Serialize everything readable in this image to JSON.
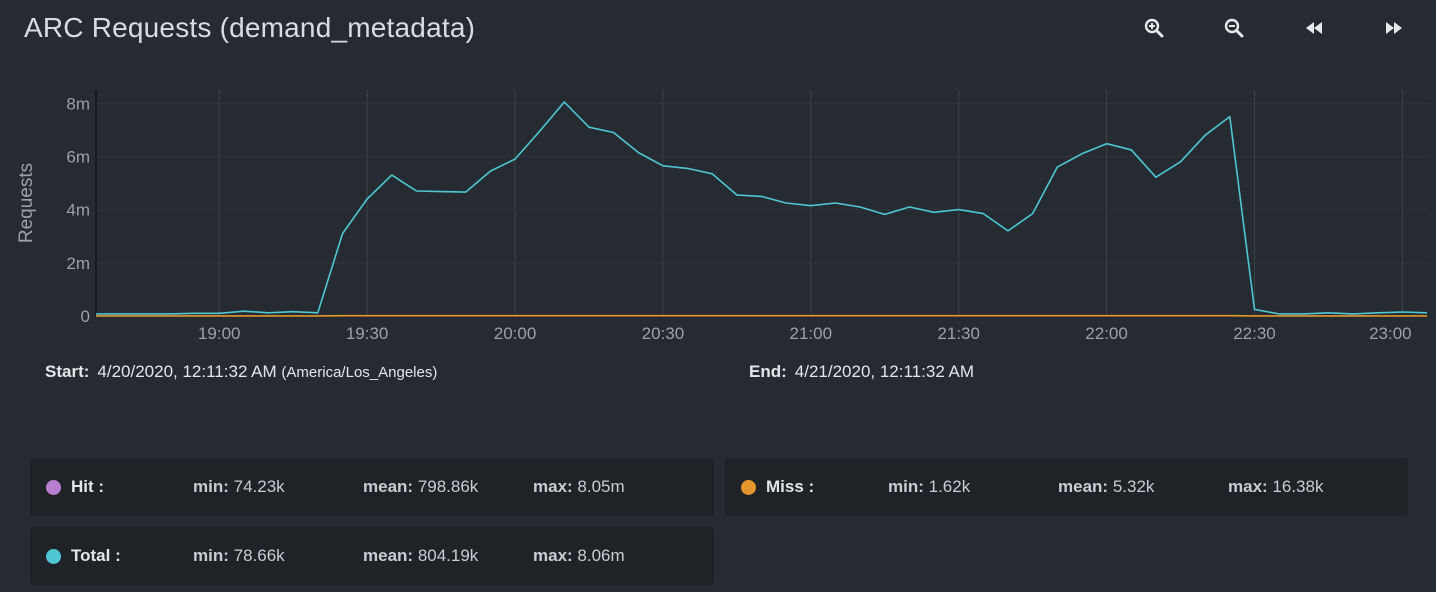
{
  "header": {
    "title": "ARC Requests (demand_metadata)",
    "toolbar": [
      {
        "name": "zoom-in-button",
        "icon": "zoom-in-icon"
      },
      {
        "name": "zoom-out-button",
        "icon": "zoom-out-icon"
      },
      {
        "name": "rewind-button",
        "icon": "rewind-icon"
      },
      {
        "name": "fast-forward-button",
        "icon": "fast-forward-icon"
      }
    ]
  },
  "time_range": {
    "start_label": "Start:",
    "start_value": "4/20/2020, 12:11:32 AM",
    "start_tz": "(America/Los_Angeles)",
    "end_label": "End:",
    "end_value": "4/21/2020, 12:11:32 AM"
  },
  "legend": {
    "hit": {
      "name": "Hit :",
      "color": "#b77fcf",
      "min_label": "min:",
      "min": "74.23k",
      "mean_label": "mean:",
      "mean": "798.86k",
      "max_label": "max:",
      "max": "8.05m"
    },
    "miss": {
      "name": "Miss :",
      "color": "#e5952e",
      "min_label": "min:",
      "min": "1.62k",
      "mean_label": "mean:",
      "mean": "5.32k",
      "max_label": "max:",
      "max": "16.38k"
    },
    "total": {
      "name": "Total :",
      "color": "#4fc7d3",
      "min_label": "min:",
      "min": "78.66k",
      "mean_label": "mean:",
      "mean": "804.19k",
      "max_label": "max:",
      "max": "8.06m"
    }
  },
  "chart_data": {
    "type": "line",
    "title": "",
    "xlabel": "",
    "ylabel": "Requests",
    "xlim": [
      "18:35",
      "23:05"
    ],
    "ylim": [
      0,
      8.5
    ],
    "y_unit": "m",
    "x_ticks": [
      "19:00",
      "19:30",
      "20:00",
      "20:30",
      "21:00",
      "21:30",
      "22:00",
      "22:30",
      "23:00"
    ],
    "y_ticks": [
      "0",
      "2m",
      "4m",
      "6m",
      "8m"
    ],
    "grid": true,
    "x": [
      "18:35",
      "18:40",
      "18:45",
      "18:50",
      "18:55",
      "19:00",
      "19:05",
      "19:10",
      "19:15",
      "19:20",
      "19:25",
      "19:30",
      "19:35",
      "19:40",
      "19:45",
      "19:50",
      "19:55",
      "20:00",
      "20:05",
      "20:10",
      "20:15",
      "20:20",
      "20:25",
      "20:30",
      "20:35",
      "20:40",
      "20:45",
      "20:50",
      "20:55",
      "21:00",
      "21:05",
      "21:10",
      "21:15",
      "21:20",
      "21:25",
      "21:30",
      "21:35",
      "21:40",
      "21:45",
      "21:50",
      "21:55",
      "22:00",
      "22:05",
      "22:10",
      "22:15",
      "22:20",
      "22:25",
      "22:30",
      "22:35",
      "22:40",
      "22:45",
      "22:50",
      "22:55",
      "23:00",
      "23:05"
    ],
    "series": [
      {
        "name": "Total",
        "color": "#4fc7d3",
        "values": [
          0.08,
          0.08,
          0.08,
          0.08,
          0.1,
          0.1,
          0.18,
          0.12,
          0.16,
          0.12,
          3.1,
          4.4,
          5.3,
          4.7,
          4.68,
          4.66,
          5.45,
          5.9,
          6.95,
          8.05,
          7.1,
          6.9,
          6.15,
          5.65,
          5.55,
          5.35,
          4.55,
          4.5,
          4.25,
          4.15,
          4.25,
          4.1,
          3.82,
          4.1,
          3.9,
          4.0,
          3.85,
          3.2,
          3.85,
          5.6,
          6.1,
          6.48,
          6.25,
          5.22,
          5.8,
          6.8,
          7.5,
          0.25,
          0.08,
          0.08,
          0.12,
          0.08,
          0.12,
          0.15,
          0.12
        ]
      },
      {
        "name": "Miss",
        "color": "#e5952e",
        "values": [
          0.005,
          0.005,
          0.005,
          0.005,
          0.005,
          0.005,
          0.005,
          0.005,
          0.005,
          0.005,
          0.01,
          0.01,
          0.01,
          0.01,
          0.01,
          0.01,
          0.01,
          0.01,
          0.01,
          0.01,
          0.01,
          0.01,
          0.01,
          0.01,
          0.01,
          0.01,
          0.01,
          0.01,
          0.01,
          0.01,
          0.01,
          0.01,
          0.01,
          0.01,
          0.01,
          0.01,
          0.01,
          0.01,
          0.01,
          0.01,
          0.01,
          0.01,
          0.01,
          0.01,
          0.01,
          0.01,
          0.01,
          0.005,
          0.005,
          0.005,
          0.005,
          0.005,
          0.005,
          0.005,
          0.005
        ]
      }
    ]
  }
}
